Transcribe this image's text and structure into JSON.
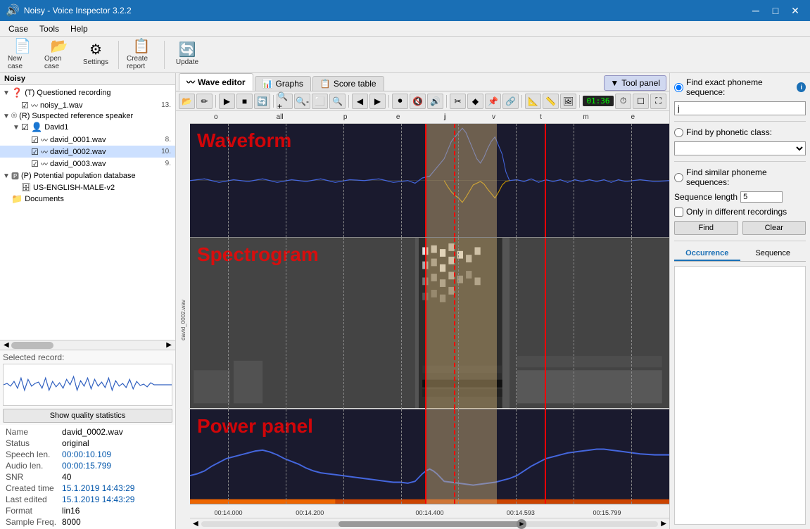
{
  "titleBar": {
    "appName": "Noisy - Voice Inspector 3.2.2",
    "minimize": "─",
    "maximize": "□",
    "close": "✕"
  },
  "menuBar": {
    "items": [
      "Case",
      "Tools",
      "Help"
    ]
  },
  "toolbar": {
    "buttons": [
      {
        "id": "new-case",
        "icon": "📄",
        "label": "New case"
      },
      {
        "id": "open-case",
        "icon": "📂",
        "label": "Open case"
      },
      {
        "id": "settings",
        "icon": "⚙",
        "label": "Settings"
      },
      {
        "id": "create-report",
        "icon": "📋",
        "label": "Create report"
      },
      {
        "id": "update",
        "icon": "🔄",
        "label": "Update"
      }
    ]
  },
  "leftPanel": {
    "header": "Noisy",
    "tree": {
      "items": [
        {
          "id": "questioned",
          "level": 0,
          "toggle": "▼",
          "checkbox": false,
          "icon": "❓",
          "label": "(T) Questioned recording",
          "value": ""
        },
        {
          "id": "noisy_1",
          "level": 1,
          "toggle": "",
          "checkbox": true,
          "icon": "🎵",
          "label": "noisy_1.wav",
          "value": "13."
        },
        {
          "id": "ref-speaker",
          "level": 0,
          "toggle": "▼",
          "checkbox": false,
          "icon": "®",
          "label": "(R) Suspected reference speaker",
          "value": ""
        },
        {
          "id": "david1",
          "level": 1,
          "toggle": "▼",
          "checkbox": true,
          "icon": "👤",
          "label": "David1",
          "value": ""
        },
        {
          "id": "david_0001",
          "level": 2,
          "toggle": "",
          "checkbox": true,
          "icon": "🎵",
          "label": "david_0001.wav",
          "value": "8."
        },
        {
          "id": "david_0002",
          "level": 2,
          "toggle": "",
          "checkbox": true,
          "icon": "🎵",
          "label": "david_0002.wav",
          "value": "10.",
          "selected": true
        },
        {
          "id": "david_0003",
          "level": 2,
          "toggle": "",
          "checkbox": true,
          "icon": "🎵",
          "label": "david_0003.wav",
          "value": "9."
        },
        {
          "id": "potential-pop",
          "level": 0,
          "toggle": "▼",
          "checkbox": false,
          "icon": "🅿",
          "label": "(P) Potential population database",
          "value": ""
        },
        {
          "id": "us-english",
          "level": 1,
          "toggle": "",
          "checkbox": false,
          "icon": "🗄",
          "label": "US-ENGLISH-MALE-v2",
          "value": ""
        },
        {
          "id": "documents",
          "level": 0,
          "toggle": "",
          "checkbox": false,
          "icon": "📁",
          "label": "Documents",
          "value": ""
        }
      ]
    },
    "selectedRecord": {
      "label": "Selected record:"
    },
    "showQualityBtn": "Show quality statistics",
    "props": [
      {
        "key": "Name",
        "value": "david_0002.wav",
        "color": "black"
      },
      {
        "key": "Status",
        "value": "original",
        "color": "black"
      },
      {
        "key": "Speech len.",
        "value": "00:00:10.109",
        "color": "blue"
      },
      {
        "key": "Audio len.",
        "value": "00:00:15.799",
        "color": "blue"
      },
      {
        "key": "SNR",
        "value": "40",
        "color": "black"
      },
      {
        "key": "Created time",
        "value": "15.1.2019 14:43:29",
        "color": "blue"
      },
      {
        "key": "Last edited",
        "value": "15.1.2019 14:43:29",
        "color": "blue"
      },
      {
        "key": "Format",
        "value": "lin16",
        "color": "black"
      },
      {
        "key": "Sample Freq.",
        "value": "8000",
        "color": "black"
      }
    ]
  },
  "centerPanel": {
    "tabs": [
      {
        "id": "wave-editor",
        "label": "Wave editor",
        "icon": "〰",
        "active": true
      },
      {
        "id": "graphs",
        "label": "Graphs",
        "icon": "📊",
        "active": false
      },
      {
        "id": "score-table",
        "label": "Score table",
        "icon": "📋",
        "active": false
      }
    ],
    "toolPanelBtn": "Tool panel",
    "waveToolbar": {
      "buttons": [
        "📂",
        "✏",
        "▶",
        "■",
        "🔄",
        "🔍+",
        "🔍-",
        "⬜",
        "🔍",
        "◀",
        "▶",
        "⏺",
        "🔇",
        "🔊",
        "⚡",
        "✂",
        "◆",
        "📌",
        "🔗",
        "📐",
        "📏",
        "🖼",
        "⏱",
        "☐",
        "⛶"
      ],
      "timeDisplay": "01:36"
    },
    "panels": [
      {
        "id": "waveform",
        "label": "Waveform"
      },
      {
        "id": "spectrogram",
        "label": "Spectrogram"
      },
      {
        "id": "power",
        "label": "Power panel"
      }
    ],
    "ruler": {
      "marks": [
        {
          "label": "00:14.000",
          "pos": 10
        },
        {
          "label": "00:14.200",
          "pos": 25
        },
        {
          "label": "00:14.400",
          "pos": 50
        },
        {
          "label": "00:14.593",
          "pos": 70
        },
        {
          "label": "00:15.799",
          "pos": 88
        }
      ]
    },
    "phonemeLabels": [
      "o",
      "all",
      "p",
      "e",
      "j",
      "v",
      "t",
      "m",
      "e"
    ],
    "currentFile": "david_0002.wav"
  },
  "rightPanel": {
    "findExactLabel": "Find exact phoneme sequence:",
    "phonemeInputValue": "j",
    "findByPhoneticLabel": "Find by phonetic class:",
    "phoneticDropdownValue": "",
    "findSimilarLabel": "Find similar phoneme sequences:",
    "seqLengthLabel": "Sequence length",
    "seqLengthValue": "5",
    "onlyDifferentLabel": "Only in different recordings",
    "findBtn": "Find",
    "clearBtn": "Clear",
    "occurrenceTab": "Occurrence",
    "sequenceTab": "Sequence"
  }
}
